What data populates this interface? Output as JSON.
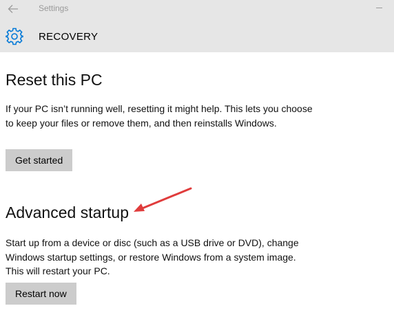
{
  "window": {
    "title": "Settings"
  },
  "header": {
    "title": "RECOVERY",
    "icon": "gear-icon"
  },
  "sections": [
    {
      "title": "Reset this PC",
      "description": "If your PC isn’t running well, resetting it might help. This lets you choose to keep your files or remove them, and then reinstalls Windows.",
      "button_label": "Get started"
    },
    {
      "title": "Advanced startup",
      "description": "Start up from a device or disc (such as a USB drive or DVD), change Windows startup settings, or restore Windows from a system image. This will restart your PC.",
      "button_label": "Restart now"
    }
  ],
  "colors": {
    "titlebar_bg": "#e6e6e6",
    "accent": "#0078d7",
    "button_bg": "#cccccc",
    "annotation_arrow": "#e03c3c"
  }
}
